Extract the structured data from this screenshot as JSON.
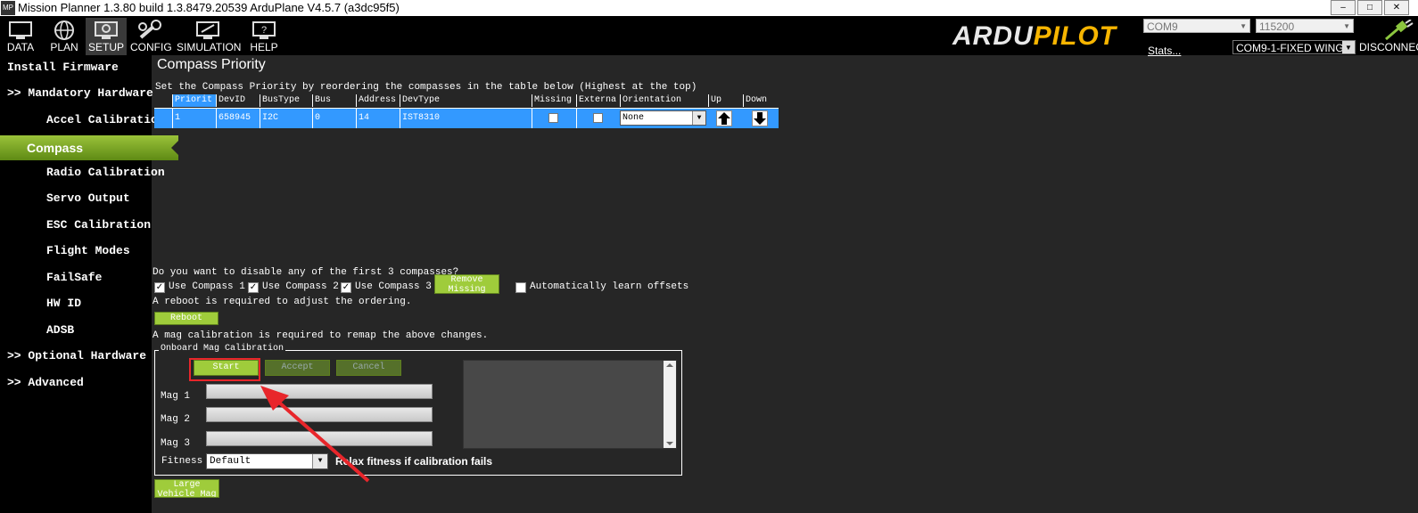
{
  "window": {
    "icon_text": "MP",
    "title": "Mission Planner 1.3.80 build 1.3.8479.20539 ArduPlane V4.5.7 (a3dc95f5)",
    "min": "–",
    "max": "□",
    "close": "✕"
  },
  "nav": [
    {
      "label": "DATA",
      "icon": "monitor-icon"
    },
    {
      "label": "PLAN",
      "icon": "globe-icon"
    },
    {
      "label": "SETUP",
      "icon": "setup-icon"
    },
    {
      "label": "CONFIG",
      "icon": "wrench-icon"
    },
    {
      "label": "SIMULATION",
      "icon": "simulation-icon"
    },
    {
      "label": "HELP",
      "icon": "help-icon"
    }
  ],
  "logo": {
    "part1": "ARDU",
    "part2": "PILOT"
  },
  "connection": {
    "port": "COM9",
    "baud": "115200",
    "firmware": "COM9-1-FIXED WING",
    "stats": "Stats...",
    "disconnect": "DISCONNECT"
  },
  "sidebar": [
    {
      "label": "Install Firmware"
    },
    {
      "label": ">> Mandatory Hardware"
    },
    {
      "label": "Accel Calibration"
    },
    {
      "label": "Compass"
    },
    {
      "label": "Radio Calibration"
    },
    {
      "label": "Servo Output"
    },
    {
      "label": "ESC Calibration"
    },
    {
      "label": "Flight Modes"
    },
    {
      "label": "FailSafe"
    },
    {
      "label": "HW ID"
    },
    {
      "label": "ADSB"
    },
    {
      "label": ">> Optional Hardware"
    },
    {
      "label": ">> Advanced"
    }
  ],
  "main": {
    "title": "Compass Priority",
    "instructions": "Set the Compass Priority by reordering the compasses in the table below (Highest at the top)",
    "table": {
      "columns": [
        "Priorit",
        "DevID",
        "BusType",
        "Bus",
        "Address",
        "DevType",
        "Missing",
        "Externa",
        "Orientation",
        "Up",
        "Down"
      ],
      "rows": [
        {
          "priority": "1",
          "devid": "658945",
          "bustype": "I2C",
          "bus": "0",
          "address": "14",
          "devtype": "IST8310",
          "missing": false,
          "external": false,
          "orientation": "None"
        }
      ]
    },
    "disable_question": "Do you want to disable any of the first 3 compasses?",
    "use_compass_1": "Use Compass 1",
    "use_compass_2": "Use Compass 2",
    "use_compass_3": "Use Compass 3",
    "remove_missing": "Remove Missing",
    "auto_learn": "Automatically learn offsets",
    "reboot_note": "A reboot is required to adjust the ordering.",
    "reboot_button": "Reboot",
    "mag_note": "A mag calibration is required to remap the above changes.",
    "onboard": {
      "legend": "Onboard Mag Calibration",
      "start": "Start",
      "accept": "Accept",
      "cancel": "Cancel",
      "mag1": "Mag 1",
      "mag2": "Mag 2",
      "mag3": "Mag 3",
      "fitness_label": "Fitness",
      "fitness_value": "Default",
      "relax": "Relax fitness if calibration fails"
    },
    "large_vehicle": "Large Vehicle Mag"
  }
}
